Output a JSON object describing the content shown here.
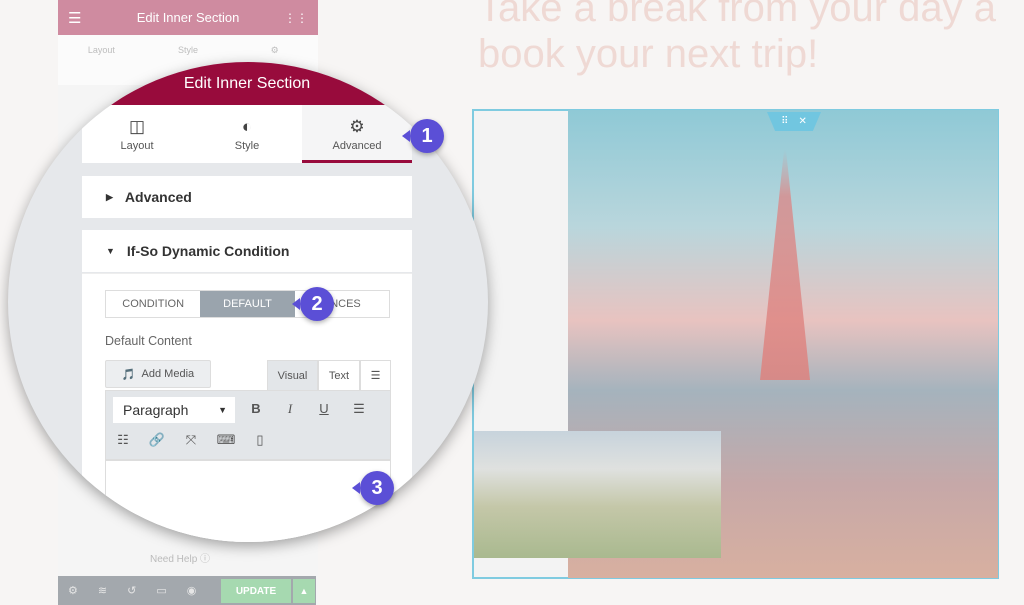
{
  "background_editor": {
    "title": "Edit Inner Section",
    "tabs": [
      "Layout",
      "Style",
      ""
    ],
    "need_help": "Need Help",
    "update_label": "UPDATE"
  },
  "page": {
    "heading_line1": "Take a break from your day a",
    "heading_line2": "book your next trip!"
  },
  "magnified_panel": {
    "title": "Edit Inner Section",
    "tabs": [
      {
        "label": "Layout",
        "icon": "columns-icon"
      },
      {
        "label": "Style",
        "icon": "half-circle-icon"
      },
      {
        "label": "Advanced",
        "icon": "gear-icon",
        "active": true
      }
    ],
    "sections": {
      "advanced": "Advanced",
      "ifso": "If-So Dynamic Condition"
    },
    "segment_tabs": [
      "CONDITION",
      "DEFAULT",
      "ENCES"
    ],
    "active_segment": "DEFAULT",
    "default_content_label": "Default Content",
    "add_media_label": "Add Media",
    "editor_tabs": [
      "Visual",
      "Text"
    ],
    "format_select": "Paragraph",
    "toolbar_buttons": [
      "B",
      "I",
      "U"
    ]
  },
  "callouts": [
    "1",
    "2",
    "3"
  ],
  "colors": {
    "brand": "#980b3c",
    "callout": "#5b4fd6",
    "update": "#a6d9b0",
    "frame": "#7fcbe0"
  }
}
